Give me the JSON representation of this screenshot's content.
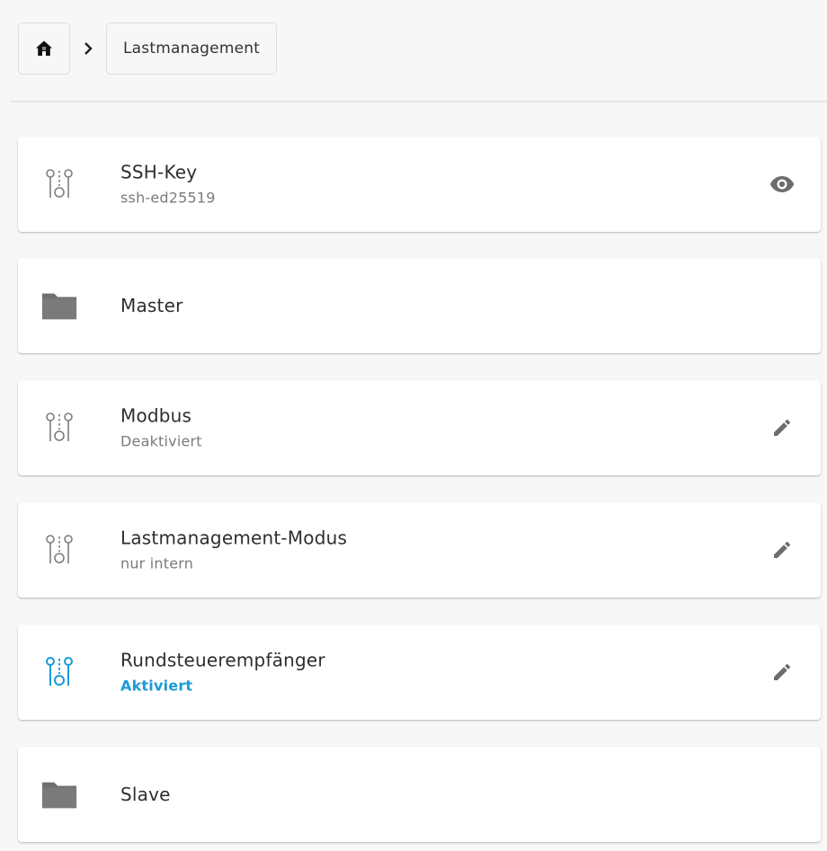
{
  "breadcrumb": {
    "home_icon": "home-icon",
    "separator_icon": "chevron-right-icon",
    "current": "Lastmanagement"
  },
  "colors": {
    "accent": "#1a9ad6",
    "icon_gray": "#7d7d7d",
    "folder_gray": "#6f6f6f"
  },
  "items": [
    {
      "icon": "settings-toggle-icon",
      "title": "SSH-Key",
      "subtitle": "ssh-ed25519",
      "action": "eye-icon"
    },
    {
      "icon": "folder-icon",
      "title": "Master"
    },
    {
      "icon": "settings-toggle-icon",
      "title": "Modbus",
      "subtitle": "Deaktiviert",
      "action": "pencil-icon"
    },
    {
      "icon": "settings-toggle-icon",
      "title": "Lastmanagement-Modus",
      "subtitle": "nur intern",
      "action": "pencil-icon"
    },
    {
      "icon": "settings-toggle-icon",
      "title": "Rundsteuerempfänger",
      "subtitle": "Aktiviert",
      "action": "pencil-icon",
      "state": "active"
    },
    {
      "icon": "folder-icon",
      "title": "Slave"
    }
  ]
}
